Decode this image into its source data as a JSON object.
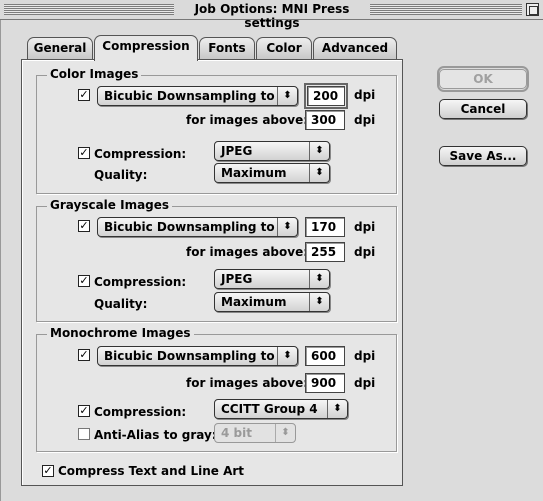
{
  "window": {
    "title": "Job Options: MNI Press settings"
  },
  "tabs": [
    {
      "label": "General",
      "active": false
    },
    {
      "label": "Compression",
      "active": true
    },
    {
      "label": "Fonts",
      "active": false
    },
    {
      "label": "Color",
      "active": false
    },
    {
      "label": "Advanced",
      "active": false
    }
  ],
  "common": {
    "dpi": "dpi",
    "check": "✓",
    "arrows": "⬍"
  },
  "color": {
    "title": "Color Images",
    "downsample_checked": true,
    "downsample_method": "Bicubic Downsampling to",
    "resolution": "200",
    "above_label": "for images above:",
    "above_value": "300",
    "compression_label": "Compression:",
    "compression_checked": true,
    "compression_value": "JPEG",
    "quality_label": "Quality:",
    "quality_value": "Maximum"
  },
  "grayscale": {
    "title": "Grayscale Images",
    "downsample_checked": true,
    "downsample_method": "Bicubic Downsampling to",
    "resolution": "170",
    "above_label": "for images above:",
    "above_value": "255",
    "compression_label": "Compression:",
    "compression_checked": true,
    "compression_value": "JPEG",
    "quality_label": "Quality:",
    "quality_value": "Maximum"
  },
  "monochrome": {
    "title": "Monochrome Images",
    "downsample_checked": true,
    "downsample_method": "Bicubic Downsampling to",
    "resolution": "600",
    "above_label": "for images above:",
    "above_value": "900",
    "compression_label": "Compression:",
    "compression_checked": true,
    "compression_value": "CCITT Group 4",
    "antialias_label": "Anti-Alias to gray:",
    "antialias_checked": false,
    "antialias_value": "4 bit"
  },
  "compress_text": {
    "label": "Compress Text and Line Art",
    "checked": true
  },
  "buttons": {
    "ok": "OK",
    "cancel": "Cancel",
    "save_as": "Save As..."
  }
}
